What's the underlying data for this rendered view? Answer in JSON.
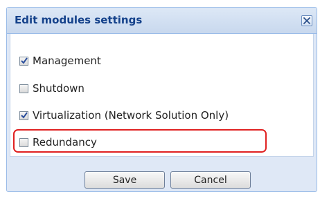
{
  "dialog": {
    "title": "Edit modules settings",
    "close_icon": "close-icon",
    "options": [
      {
        "label": "Management",
        "checked": true
      },
      {
        "label": "Shutdown",
        "checked": false
      },
      {
        "label": "Virtualization (Network Solution Only)",
        "checked": true,
        "highlighted": true
      },
      {
        "label": "Redundancy",
        "checked": false
      }
    ],
    "buttons": {
      "save_label": "Save",
      "cancel_label": "Cancel"
    }
  },
  "colors": {
    "title_text": "#15428b",
    "dialog_border": "#99bbe8",
    "dialog_background": "#dfe8f6",
    "highlight_border": "#e02020"
  }
}
